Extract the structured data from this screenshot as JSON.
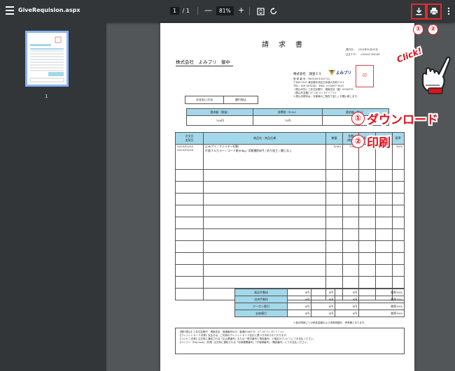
{
  "toolbar": {
    "title": "GiveRequision.aspx",
    "page_current": "1",
    "page_total": "/ 1",
    "zoom_out": "—",
    "zoom": "81%",
    "zoom_in": "+",
    "fit_icon": "fit-page-icon",
    "rotate_icon": "rotate-icon",
    "download_icon": "download-icon",
    "print_icon": "print-icon",
    "more_icon": "more-vertical-icon"
  },
  "sidebar": {
    "thumbnail_label": "1"
  },
  "annotations": {
    "marker_download": "①",
    "marker_print": "②",
    "click_text": "Click!",
    "download_num": "①",
    "download_label": "ダウンロード",
    "print_num": "②",
    "print_label": "印刷",
    "accent_color": "#e1111b"
  },
  "doc": {
    "title": "請　求　書",
    "issue_date": "発行日：　2023年10月25日",
    "order_id": "注文ＩＤ：　230025-000241",
    "addressee": "株式会社　よみプリ　御中",
    "issuer_name": "株式会社　調査ＩＳ",
    "logo_text": "よみプリ",
    "issuer_lines": [
      "登 録 番 号：T6010001033722",
      "〒460-0021 東京都中央区日本橋人形町3-9-1",
      "TEL：026-58-4343　FAX：03-5667-1633",
      "《振込み先》三井住友銀行　湘南支店（普）6556578",
      "《振込先名義》ｶﾌﾞｼｷｶﾞｲｼｬ ﾖﾐﾌﾟﾘ ﾌﾟﾘﾝﾄ",
      "※振込手数料は、お客様のご負担で宜しくお願い致します。"
    ],
    "stamp_text": "印",
    "payment_label": "お支払い方法",
    "payment_value": "銀行振込",
    "summary_headers": [
      "請求額（税抜）",
      "消費税（10%）",
      "請求額（税込）"
    ],
    "summary_values": [
      "700円",
      "70円",
      "770円"
    ],
    "items_headers": [
      "注文日\n出荷日",
      "商品名・商品仕様",
      "数量",
      "金額\n(税抜)",
      "消費税",
      "合計",
      "税率"
    ],
    "item_dates": [
      "2023/10/25",
      "2023/10/26"
    ],
    "item_name": "よみプリ / ファイヤー印刷",
    "item_spec": "片面フルカラー / コート紙90kg / 用紙種別6円 / 折り加工 / 綴じなし",
    "item_values": [
      "1000",
      "700円",
      "70円",
      "770円",
      "10%"
    ],
    "totals_labels": [
      "発送手数料",
      "決済手数料",
      "クーポン割引",
      "全体値引"
    ],
    "totals_values": [
      "0円",
      "0円",
      "0円",
      "税率10%"
    ],
    "note": "※各月明細ごとの税抜金額および消費税額を、併考欄となります。",
    "remarks": [
      "【銀行振込】三井住友銀行　湘南支店　普通番号628　普通6566578　ｶﾌﾞｼｷｶﾞｲｼｬ ﾖﾐﾌﾟﾘ ﾌﾟﾘﾝﾄ",
      "【クレジットカード決済】支払日は、ご利用のクレジットカード会社に基づき決められております。",
      "【コンビニ決済】注文時に通知される「払込票番号」または「受付番号と電話番号」で指定のコンビニにてお支払ください。",
      "【ペイジー（Pay-easy）決済】注文時に通知される「収納機関番号」「お客様番号」「確認番号」にてお支払ください。"
    ]
  }
}
